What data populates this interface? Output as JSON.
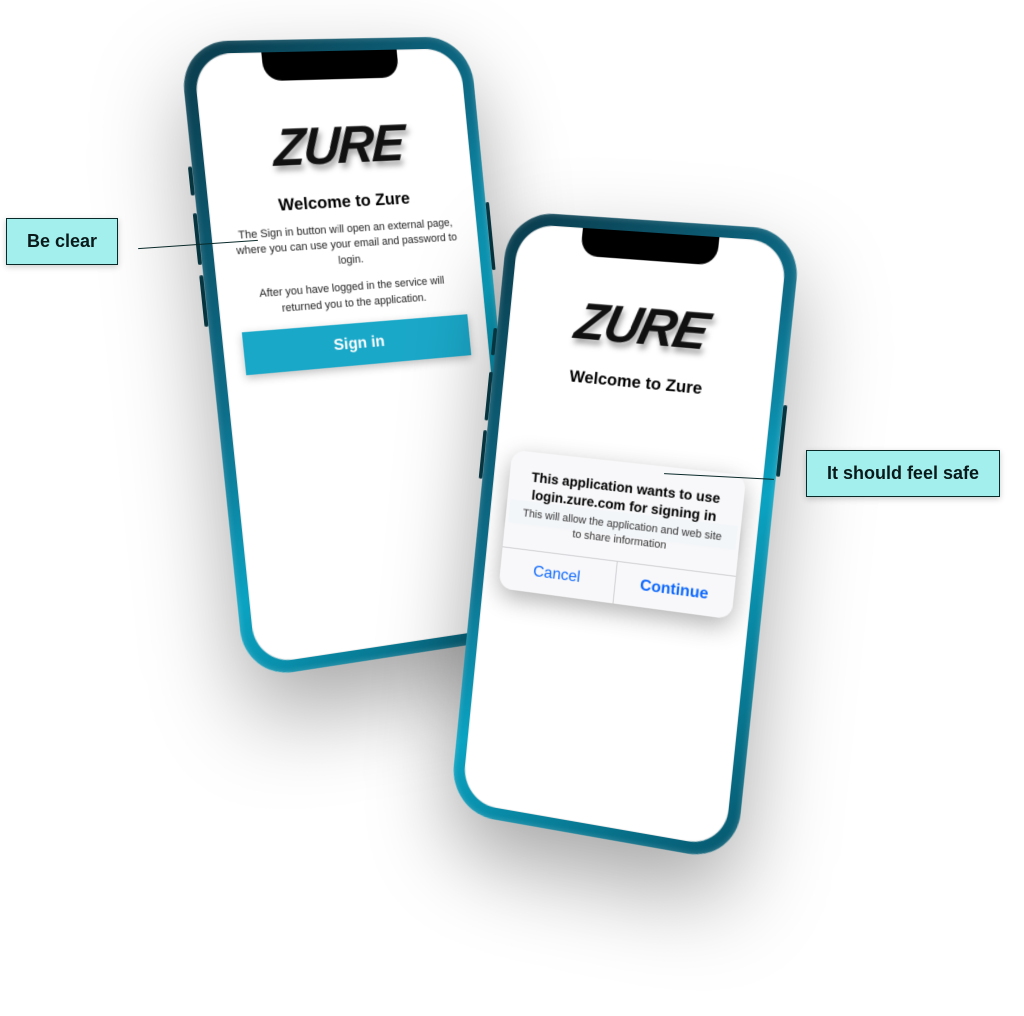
{
  "brand": {
    "logo_text": "ZURE"
  },
  "left_phone": {
    "welcome": "Welcome to Zure",
    "description_1": "The Sign in button will open an external page, where you can use your email and password to login.",
    "description_2": "After you have logged in the service will returned you to the application.",
    "signin_label": "Sign in"
  },
  "right_phone": {
    "welcome": "Welcome to Zure",
    "alert": {
      "title": "This application wants to use login.zure.com for signing in",
      "message": "This will allow the application and web site to share information",
      "cancel": "Cancel",
      "continue": "Continue"
    }
  },
  "callouts": {
    "left": "Be clear",
    "right": "It should feel safe"
  },
  "colors": {
    "accent": "#1aa8c9",
    "callout_bg": "#a3efee",
    "ios_blue": "#0a66ff"
  }
}
